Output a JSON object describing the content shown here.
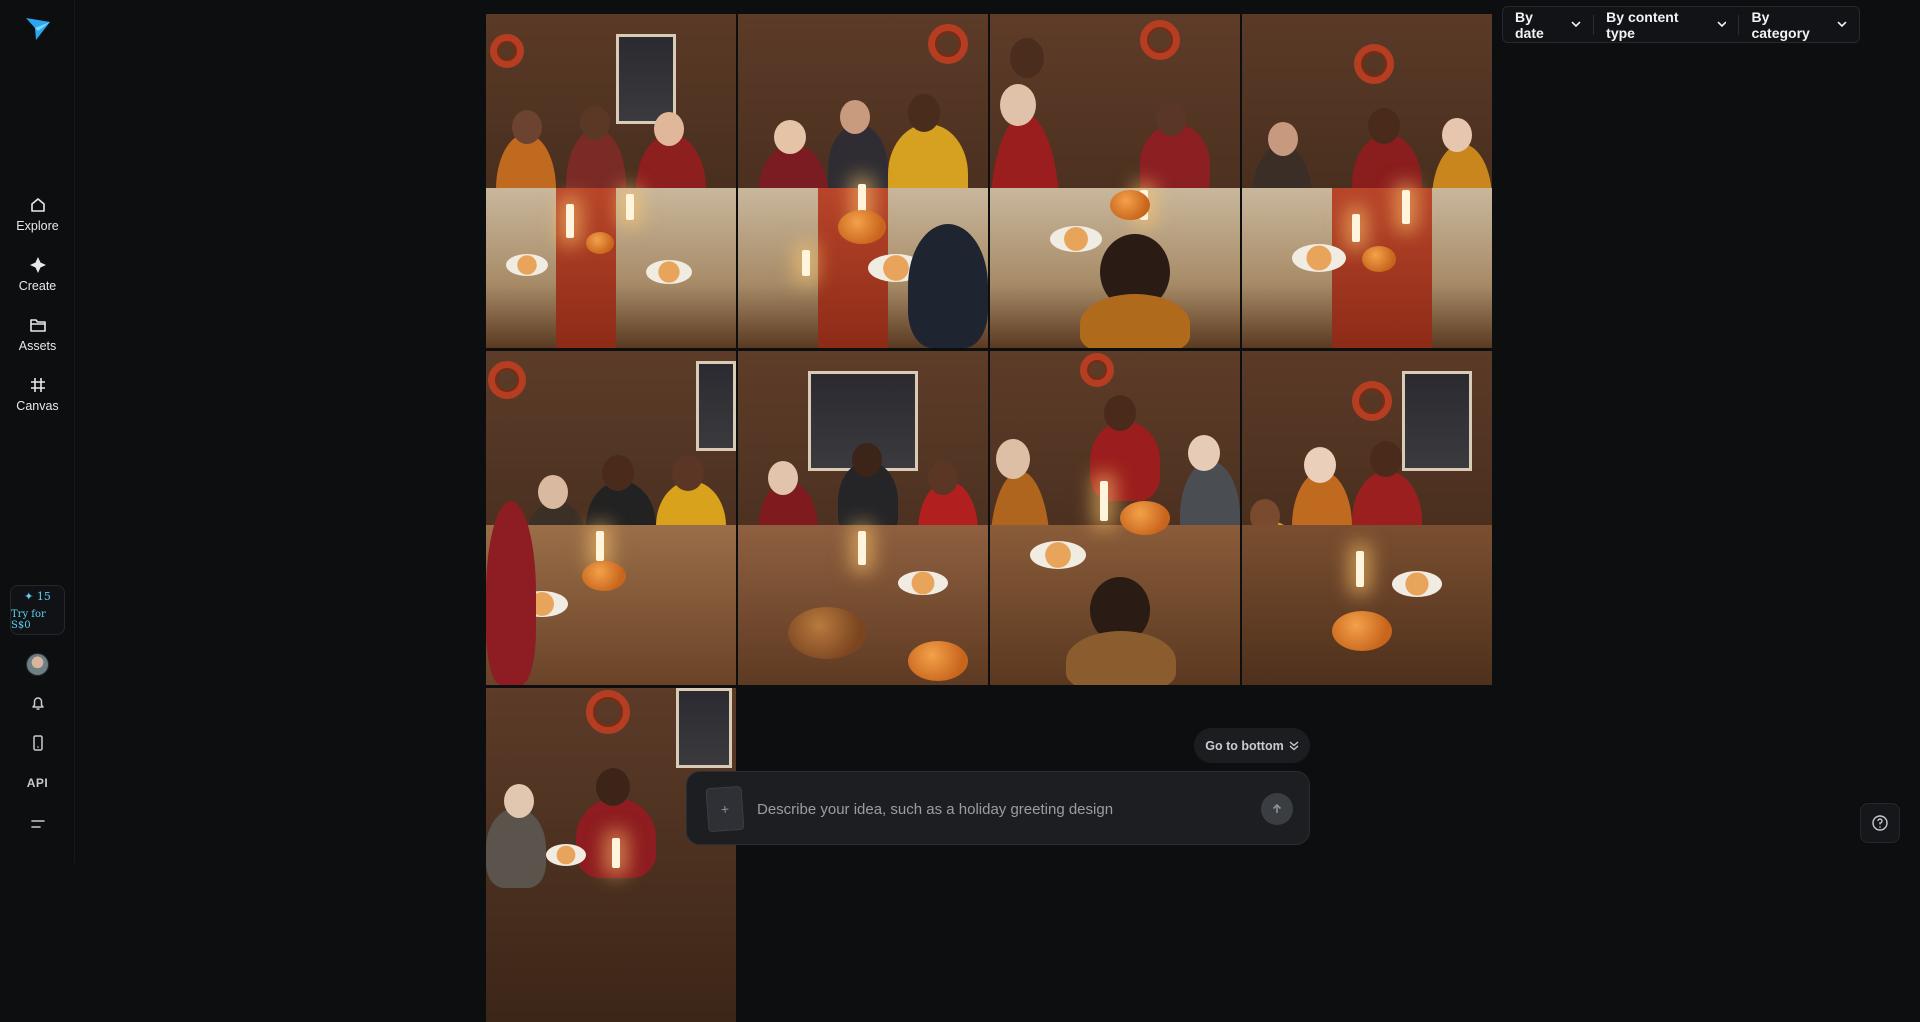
{
  "sidebar": {
    "logo_icon": "paper-plane-logo",
    "nav": [
      {
        "label": "Explore",
        "icon": "home-icon"
      },
      {
        "label": "Create",
        "icon": "sparkle-icon"
      },
      {
        "label": "Assets",
        "icon": "folder-icon"
      },
      {
        "label": "Canvas",
        "icon": "canvas-icon"
      }
    ],
    "credits": {
      "count": "✦ 15",
      "try_label": "Try for S$0"
    },
    "api_label": "API"
  },
  "filters": [
    {
      "label": "By date"
    },
    {
      "label": "By content type"
    },
    {
      "label": "By category"
    }
  ],
  "gallery": {
    "images": [
      {
        "alt": "Family gathered around holiday dinner table"
      },
      {
        "alt": "Family laughing at candlelit holiday dinner"
      },
      {
        "alt": "Grandmother and family at festive table"
      },
      {
        "alt": "Multigenerational family enjoying holiday meal"
      },
      {
        "alt": "Smiling family seated at autumn dinner"
      },
      {
        "alt": "Family around roasted turkey centerpiece"
      },
      {
        "alt": "Family gathered at wooden dinner table"
      },
      {
        "alt": "Family sharing candlelit autumn feast"
      },
      {
        "alt": "Family smiling around holiday table"
      }
    ]
  },
  "go_to_bottom_label": "Go to bottom",
  "prompt": {
    "placeholder": "Describe your idea, such as a holiday greeting design"
  },
  "colors": {
    "accent": "#5fd1f5",
    "background": "#0d0e10"
  }
}
